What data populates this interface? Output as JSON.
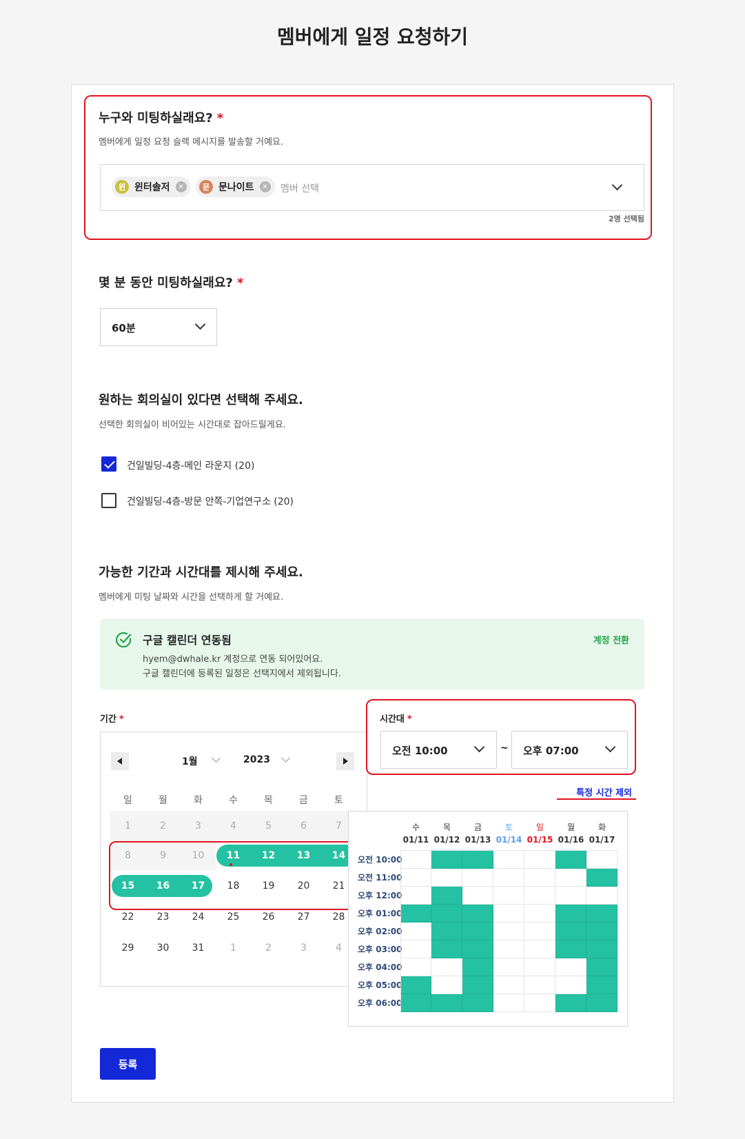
{
  "page_title": "멤버에게 일정 요청하기",
  "who": {
    "title": "누구와 미팅하실래요?",
    "required_mark": "*",
    "desc": "멤버에게 일정 요청 슬랙 메시지를 발송할 거예요.",
    "chips": [
      {
        "avatar": "윈",
        "name": "윈터솔저",
        "color": "#c7c23f"
      },
      {
        "avatar": "문",
        "name": "문나이트",
        "color": "#d9845a"
      }
    ],
    "placeholder": "멤버 선택",
    "selected_count": "2명 선택됨"
  },
  "duration": {
    "title": "몇 분 동안 미팅하실래요?",
    "required_mark": "*",
    "value": "60분"
  },
  "room": {
    "title": "원하는 회의실이 있다면 선택해 주세요.",
    "desc": "선택한 회의실이 비어있는 시간대로 잡아드릴게요.",
    "options": [
      {
        "label": "건일빌딩-4층-메인 라운지 (20)",
        "checked": true
      },
      {
        "label": "건일빌딩-4층-방문 안쪽-기업연구소 (20)",
        "checked": false
      }
    ]
  },
  "period": {
    "title": "가능한 기간과 시간대를 제시해 주세요.",
    "desc": "멤버에게 미팅 날짜와 시간을 선택하게 할 거예요."
  },
  "gcal": {
    "title": "구글 캘린더 연동됨",
    "line1": "hyem@dwhale.kr 계정으로 연동 되어있어요.",
    "line2": "구글 캘린더에 등록된 일정은 선택지에서 제외됩니다.",
    "switch": "계정 전환"
  },
  "calendar": {
    "label": "기간",
    "required_mark": "*",
    "month": "1월",
    "year": "2023",
    "weekdays": [
      "일",
      "월",
      "화",
      "수",
      "목",
      "금",
      "토"
    ],
    "weeks": [
      [
        "1",
        "2",
        "3",
        "4",
        "5",
        "6",
        "7"
      ],
      [
        "8",
        "9",
        "10",
        "11",
        "12",
        "13",
        "14"
      ],
      [
        "15",
        "16",
        "17",
        "18",
        "19",
        "20",
        "21"
      ],
      [
        "22",
        "23",
        "24",
        "25",
        "26",
        "27",
        "28"
      ],
      [
        "29",
        "30",
        "31",
        "1",
        "2",
        "3",
        "4"
      ]
    ]
  },
  "timeslot": {
    "label": "시간대",
    "required_mark": "*",
    "start": "오전 10:00",
    "tilde": "~",
    "end": "오후 07:00",
    "exclude": "특정 시간 제외"
  },
  "grid": {
    "days": [
      {
        "dow": "수",
        "date": "01/11"
      },
      {
        "dow": "목",
        "date": "01/12"
      },
      {
        "dow": "금",
        "date": "01/13"
      },
      {
        "dow": "토",
        "date": "01/14"
      },
      {
        "dow": "일",
        "date": "01/15"
      },
      {
        "dow": "월",
        "date": "01/16"
      },
      {
        "dow": "화",
        "date": "01/17"
      }
    ],
    "times": [
      "오전 10:00",
      "오전 11:00",
      "오후 12:00",
      "오후 01:00",
      "오후 02:00",
      "오후 03:00",
      "오후 04:00",
      "오후 05:00",
      "오후 06:00"
    ],
    "cells": [
      [
        0,
        1,
        1,
        0,
        0,
        1,
        0
      ],
      [
        0,
        0,
        0,
        0,
        0,
        0,
        1
      ],
      [
        0,
        1,
        0,
        0,
        0,
        0,
        0
      ],
      [
        1,
        1,
        1,
        0,
        0,
        1,
        1
      ],
      [
        0,
        1,
        1,
        0,
        0,
        1,
        1
      ],
      [
        0,
        1,
        1,
        0,
        0,
        1,
        1
      ],
      [
        0,
        0,
        1,
        0,
        0,
        0,
        1
      ],
      [
        1,
        0,
        1,
        0,
        0,
        0,
        1
      ],
      [
        1,
        1,
        1,
        0,
        0,
        1,
        1
      ]
    ]
  },
  "submit": "등록"
}
